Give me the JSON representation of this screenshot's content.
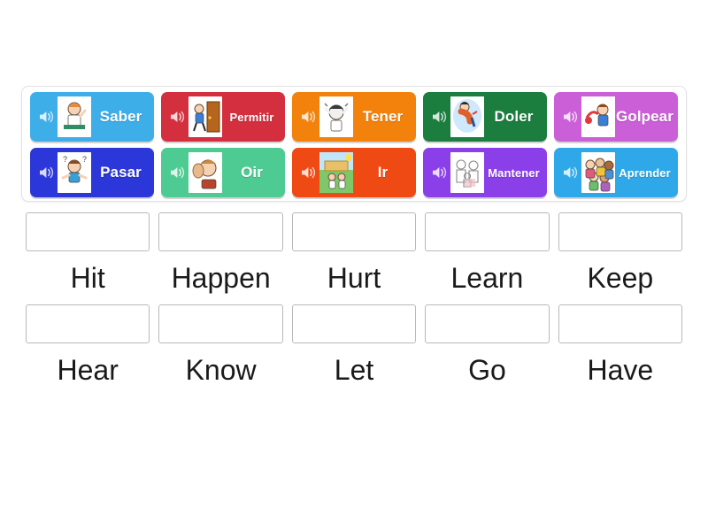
{
  "app": {
    "type": "match-up-drag-drop-activity",
    "background_color": "#ffffff"
  },
  "tile_panel": {
    "rows": [
      [
        {
          "label": "Saber",
          "color": "#3daee8",
          "speaker_icon": "speaker-icon",
          "image": "girl-student-at-desk-raising-hand"
        },
        {
          "label": "Permitir",
          "color": "#d32f3e",
          "speaker_icon": "speaker-icon",
          "image": "person-opening-door-letting-someone-through"
        },
        {
          "label": "Tener",
          "color": "#f2820c",
          "speaker_icon": "speaker-icon",
          "image": "man-holding-head-stressed"
        },
        {
          "label": "Doler",
          "color": "#1b7d3e",
          "speaker_icon": "speaker-icon",
          "image": "person-with-back-pain"
        },
        {
          "label": "Golpear",
          "color": "#cb5fd8",
          "speaker_icon": "speaker-icon",
          "image": "boy-hitting-with-object"
        }
      ],
      [
        {
          "label": "Pasar",
          "color": "#2b37d8",
          "speaker_icon": "speaker-icon",
          "image": "confused-boy-with-question-marks"
        },
        {
          "label": "Oir",
          "color": "#4ecb92",
          "speaker_icon": "speaker-icon",
          "image": "man-cupping-ear-listening"
        },
        {
          "label": "Ir",
          "color": "#f04a14",
          "speaker_icon": "speaker-icon",
          "image": "children-walking-outdoors-to-school"
        },
        {
          "label": "Mantener",
          "color": "#8a3fe8",
          "speaker_icon": "speaker-icon",
          "image": "family-group-sketch"
        },
        {
          "label": "Aprender",
          "color": "#2ea8e8",
          "speaker_icon": "speaker-icon",
          "image": "group-of-diverse-children"
        }
      ]
    ]
  },
  "answers": {
    "rows": [
      [
        {
          "word": "Hit",
          "dropbox_value": ""
        },
        {
          "word": "Happen",
          "dropbox_value": ""
        },
        {
          "word": "Hurt",
          "dropbox_value": ""
        },
        {
          "word": "Learn",
          "dropbox_value": ""
        },
        {
          "word": "Keep",
          "dropbox_value": ""
        }
      ],
      [
        {
          "word": "Hear",
          "dropbox_value": ""
        },
        {
          "word": "Know",
          "dropbox_value": ""
        },
        {
          "word": "Let",
          "dropbox_value": ""
        },
        {
          "word": "Go",
          "dropbox_value": ""
        },
        {
          "word": "Have",
          "dropbox_value": ""
        }
      ]
    ]
  }
}
